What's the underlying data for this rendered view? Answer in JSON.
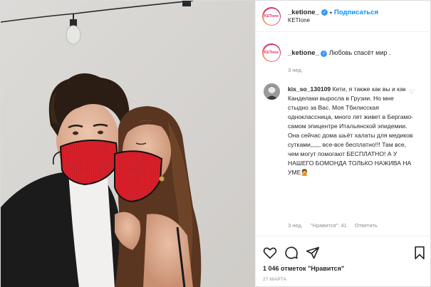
{
  "post": {
    "author": {
      "username": "_ketione_",
      "subtitle": "KETIone",
      "avatar_text": "KETIone",
      "follow_label": "Подписаться",
      "separator": "•"
    },
    "caption": {
      "username": "_ketione_",
      "text": "Любовь спасёт мир .",
      "time": "3 нед."
    },
    "comments": [
      {
        "username": "kis_so_130109",
        "text": "Кети, я также как вы и как Канделаки выросла в Грузии. Но мне стыдно за Вас. Моя Тбилисская одноклассница, много лет живет в Бергамо-самом эпицентре Итальянской эпидемии. Она сейчас дома шьёт халаты для медиков сутками,,,,,, все-все бесплатно!!! Там все, чем могут помогают БЕСПЛАТНО! А У НАШЕГО БОМОНДА ТОЛЬКО НАЖИВА НА УМЕ🤦",
        "time": "3 нед.",
        "likes": "\"Нравится\": 41",
        "reply": "Ответить"
      }
    ],
    "likes_count": "1 046 отметок",
    "likes_label": "\"Нравится\"",
    "date": "27 МАРТА",
    "icons": [
      "heart-icon",
      "comment-icon",
      "share-icon",
      "bookmark-icon",
      "verified-icon",
      "comment-like-icon"
    ],
    "colors": {
      "accent": "#0095f6",
      "verified": "#3897f0",
      "muted": "#8e8e8e",
      "mask_red": "#d8202a"
    }
  }
}
